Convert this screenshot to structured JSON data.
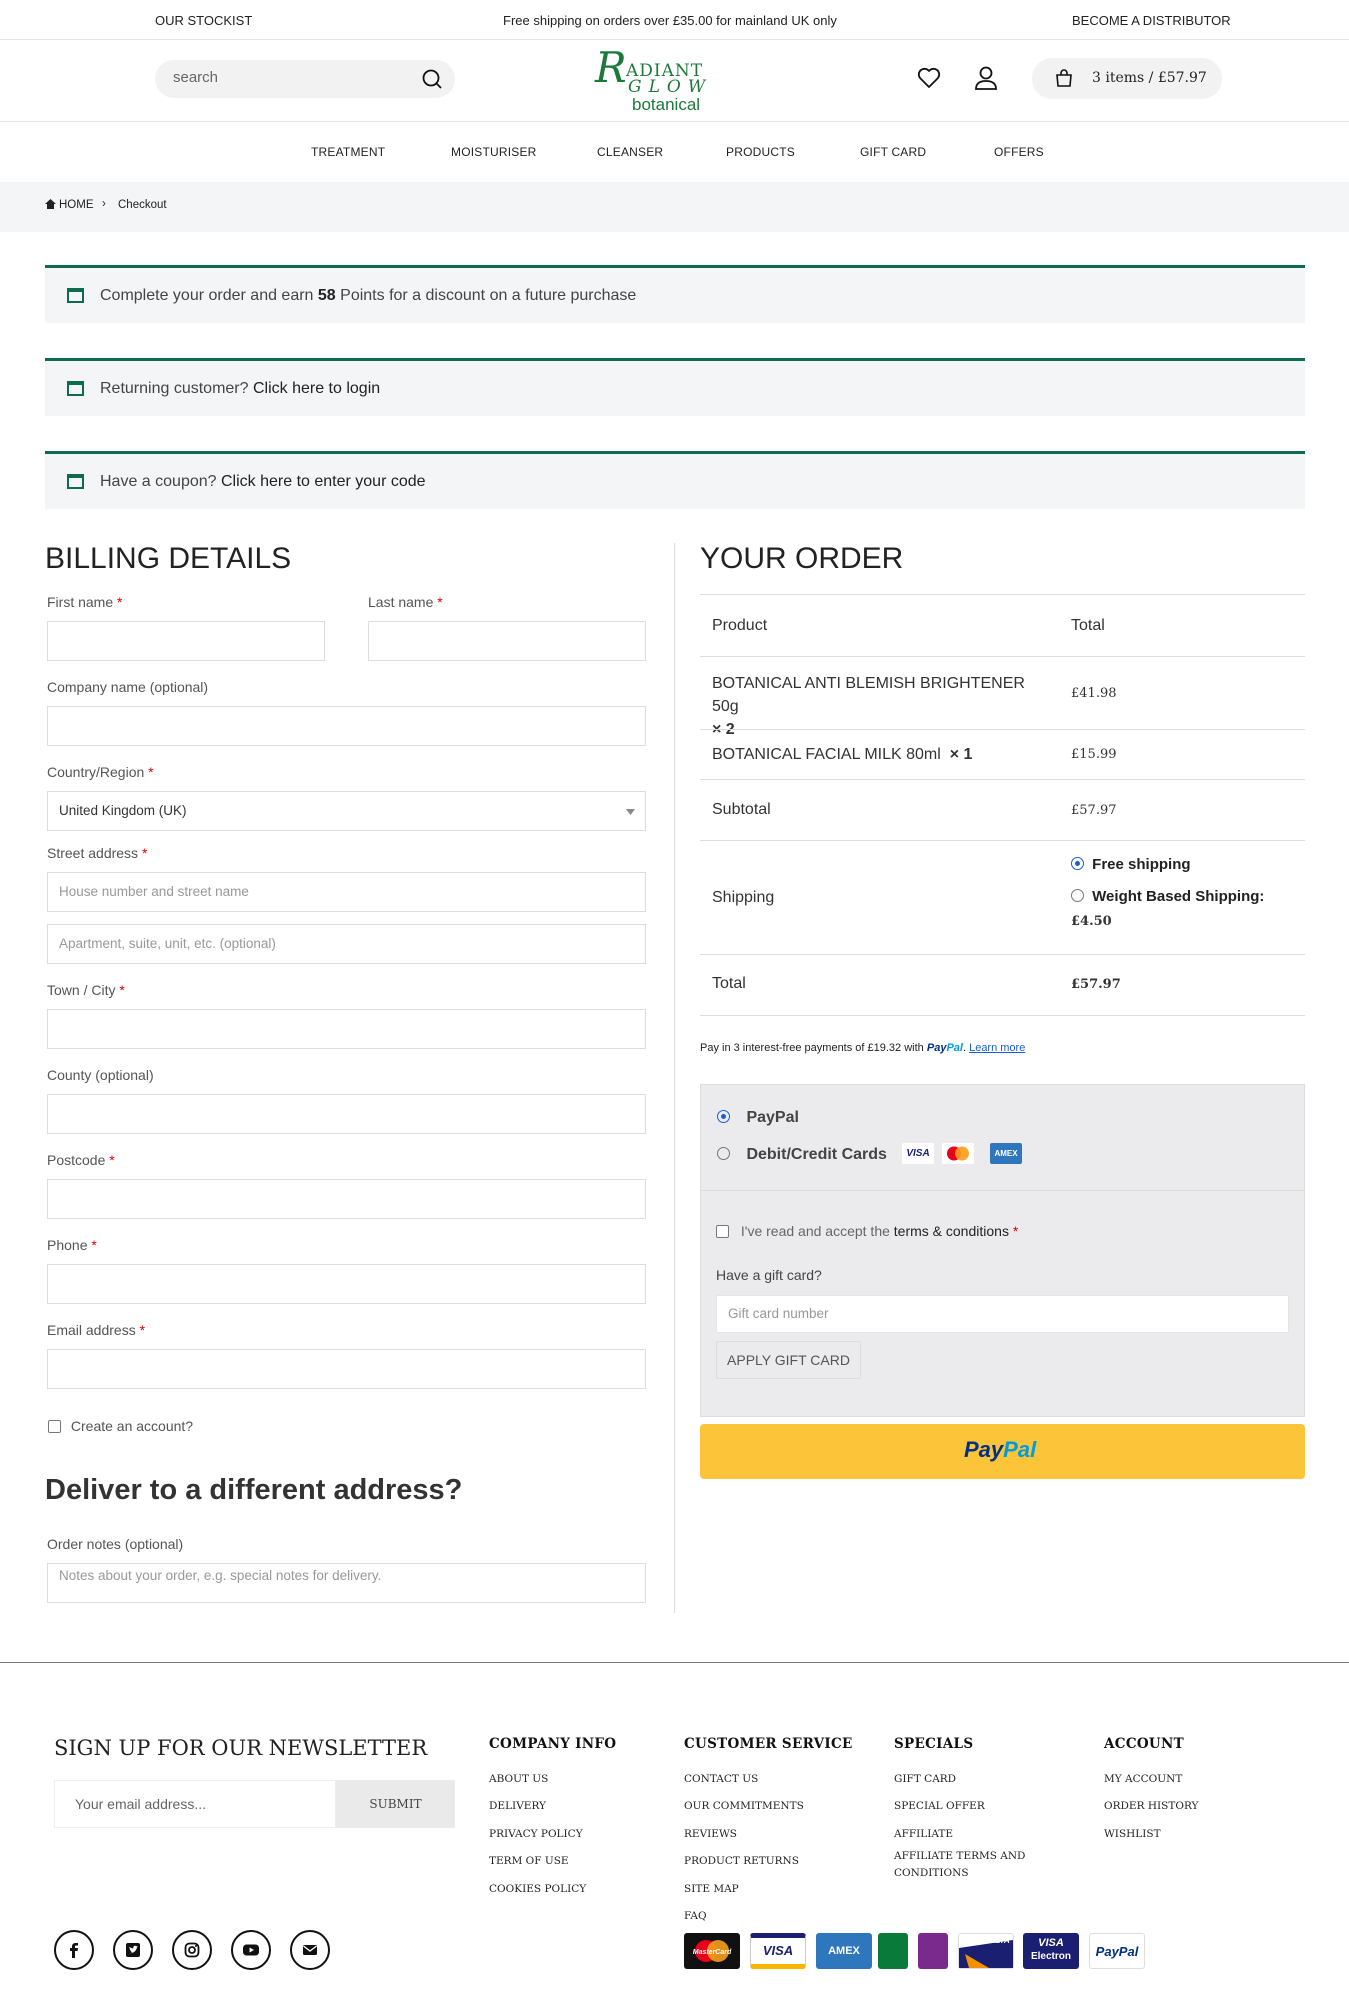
{
  "topbar": {
    "left": "OUR STOCKIST",
    "center": "Free shipping on orders over £35.00 for mainland UK only",
    "right": "BECOME A DISTRIBUTOR"
  },
  "header": {
    "search_placeholder": "search",
    "logo_line1": "ADIANT",
    "logo_letter": "R",
    "logo_line2": "GLOW",
    "logo_line3": "botanical",
    "cart_label": "3 items / £57.97"
  },
  "nav": [
    "TREATMENT",
    "MOISTURISER",
    "CLEANSER",
    "PRODUCTS",
    "GIFT CARD",
    "OFFERS"
  ],
  "breadcrumb": {
    "home": "HOME",
    "sep": "›",
    "current": "Checkout"
  },
  "notices": {
    "points_pre": "Complete your order and earn ",
    "points_val": "58",
    "points_post": " Points for a discount on a future purchase",
    "login_pre": "Returning customer? ",
    "login_link": "Click here to login",
    "coupon_pre": "Have a coupon? ",
    "coupon_link": "Click here to enter your code"
  },
  "billing": {
    "title": "BILLING DETAILS",
    "first_name": "First name",
    "last_name": "Last name",
    "company": "Company name (optional)",
    "country": "Country/Region",
    "country_value": "United Kingdom (UK)",
    "street": "Street address",
    "street_ph1": "House number and street name",
    "street_ph2": "Apartment, suite, unit, etc. (optional)",
    "town": "Town / City",
    "county": "County (optional)",
    "postcode": "Postcode",
    "phone": "Phone",
    "email": "Email address",
    "create_account": "Create an account?",
    "deliver_title": "Deliver to a different address?",
    "notes": "Order notes (optional)",
    "notes_ph": "Notes about your order, e.g. special notes for delivery.",
    "required": "*"
  },
  "order": {
    "title": "YOUR ORDER",
    "col_product": "Product",
    "col_total": "Total",
    "items": [
      {
        "name": "BOTANICAL ANTI BLEMISH BRIGHTENER 50g",
        "qty": "× 2",
        "total": "£41.98"
      },
      {
        "name": "BOTANICAL FACIAL MILK 80ml",
        "qty": "× 1",
        "total": "£15.99"
      }
    ],
    "subtotal_label": "Subtotal",
    "subtotal": "£57.97",
    "shipping_label": "Shipping",
    "ship_free": "Free shipping",
    "ship_weight": "Weight Based Shipping:",
    "ship_weight_price": "£4.50",
    "total_label": "Total",
    "total": "£57.97"
  },
  "paylater": {
    "pre": "Pay in 3 interest-free payments of £19.32 with",
    "brand1": "Pay",
    "brand2": "Pal",
    "learn": "Learn more"
  },
  "payment": {
    "paypal": "PayPal",
    "cards": "Debit/Credit Cards",
    "visa": "VISA",
    "amex": "AMEX",
    "terms_pre": "I've read and accept the ",
    "terms_link": "terms & conditions",
    "terms_req": "*",
    "gift_q": "Have a gift card?",
    "gift_ph": "Gift card number",
    "gift_btn": "APPLY GIFT CARD",
    "btn_pay": "Pay",
    "btn_pal": "Pal"
  },
  "footer": {
    "newsletter_title": "SIGN UP FOR OUR NEWSLETTER",
    "email_ph": "Your email address...",
    "submit": "SUBMIT",
    "company": {
      "title": "COMPANY INFO",
      "links": [
        "ABOUT US",
        "DELIVERY",
        "PRIVACY POLICY",
        "TERM OF USE",
        "COOKIES POLICY"
      ]
    },
    "service": {
      "title": "CUSTOMER SERVICE",
      "links": [
        "CONTACT US",
        "OUR COMMITMENTS",
        "REVIEWS",
        "PRODUCT RETURNS",
        "SITE MAP",
        "FAQ"
      ]
    },
    "specials": {
      "title": "SPECIALS",
      "links": [
        "GIFT CARD",
        "SPECIAL OFFER",
        "AFFILIATE",
        "AFFILIATE TERMS AND",
        "CONDITIONS"
      ]
    },
    "account": {
      "title": "ACCOUNT",
      "links": [
        "MY ACCOUNT",
        "ORDER HISTORY",
        "WISHLIST"
      ]
    },
    "cards": {
      "mastercard": "MasterCard",
      "visa": "VISA",
      "amex": "AMEX",
      "delta": "DELTA",
      "electron_1": "VISA",
      "electron_2": "Electron",
      "paypal": "PayPal"
    }
  }
}
